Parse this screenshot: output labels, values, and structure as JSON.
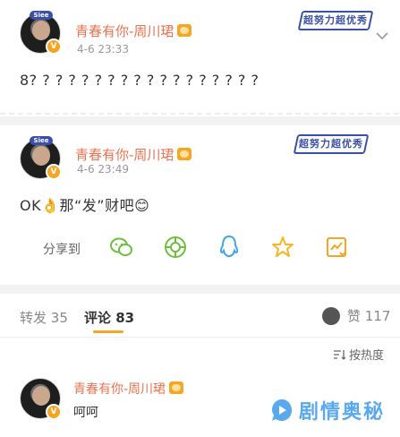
{
  "posts": [
    {
      "avatar_tag": "Siee",
      "username": "青春有你-周川珺",
      "time": "4-6 23:33",
      "badge": "超努力超优秀",
      "text": "8? ? ? ? ? ? ? ? ? ? ? ? ? ? ? ? ? ?"
    },
    {
      "avatar_tag": "Siee",
      "username": "青春有你-周川珺",
      "time": "4-6 23:49",
      "badge": "超努力超优秀",
      "text": "OK👌那“发”财吧😊"
    }
  ],
  "share": {
    "label": "分享到",
    "targets": [
      "wechat-icon",
      "moments-icon",
      "qq-icon",
      "qzone-icon",
      "save-image-icon"
    ]
  },
  "tabs": {
    "repost_label": "转发",
    "repost_count": "35",
    "comment_label": "评论",
    "comment_count": "83",
    "like_label": "赞",
    "like_count": "117"
  },
  "sort": {
    "label": "按热度"
  },
  "comment": {
    "username": "青春有你-周川珺",
    "text": "呵呵"
  },
  "watermark": {
    "text": "剧情奥秘"
  },
  "colors": {
    "accent": "#eb7350",
    "tab_underline": "#f5a623",
    "badge_blue": "#3a4fa8",
    "watermark": "#5aa9ef"
  }
}
